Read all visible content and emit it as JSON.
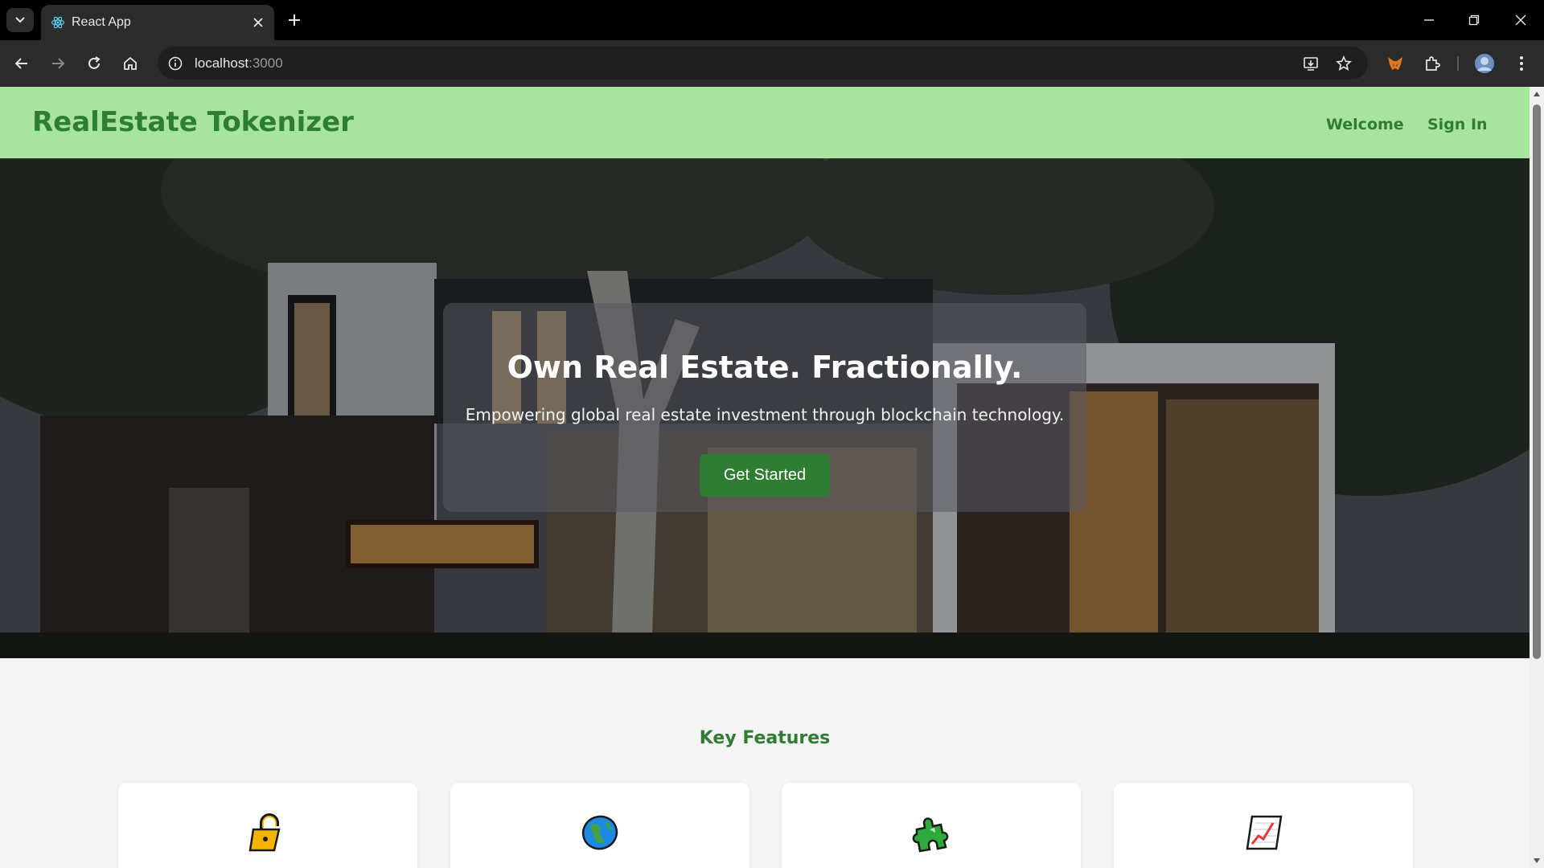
{
  "browser": {
    "tab_title": "React App",
    "url_host": "localhost",
    "url_port": ":3000"
  },
  "nav": {
    "brand": "RealEstate Tokenizer",
    "links": [
      "Welcome",
      "Sign In"
    ]
  },
  "hero": {
    "title": "Own Real Estate. Fractionally.",
    "subtitle": "Empowering global real estate investment through blockchain technology.",
    "cta_label": "Get Started"
  },
  "features": {
    "heading": "Key Features",
    "cards": [
      {
        "icon": "lock-icon"
      },
      {
        "icon": "globe-icon"
      },
      {
        "icon": "puzzle-icon"
      },
      {
        "icon": "chart-icon"
      }
    ]
  },
  "colors": {
    "navbar_bg": "#a8e4a0",
    "brand_green": "#2e7d32",
    "page_bg": "#f4f4f4"
  }
}
